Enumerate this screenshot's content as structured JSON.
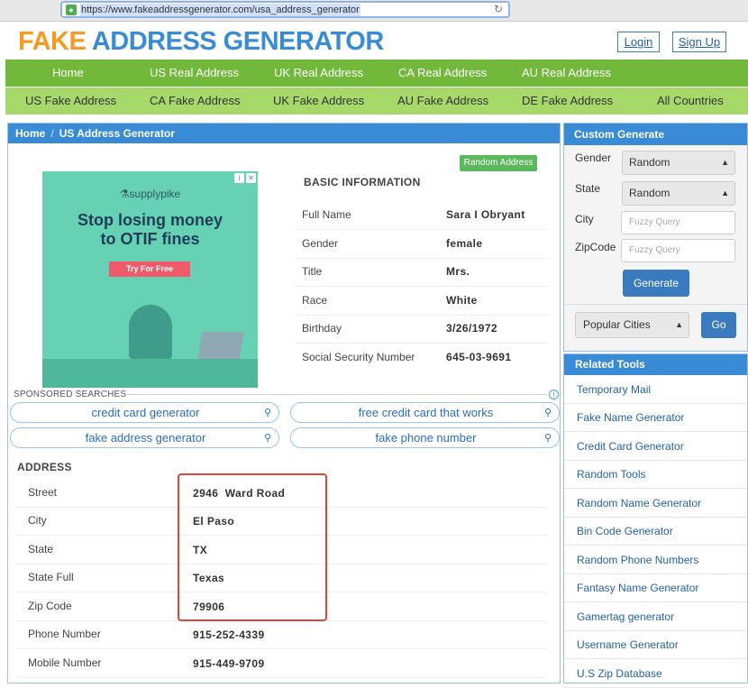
{
  "browser": {
    "url": "https://www.fakeaddressgenerator.com/usa_address_generator"
  },
  "header": {
    "logo_part1": "FAKE",
    "logo_part2": "ADDRESS GENERATOR",
    "login": "Login",
    "signup": "Sign Up"
  },
  "nav_primary": [
    "Home",
    "US Real Address",
    "UK Real Address",
    "CA Real Address",
    "AU Real Address"
  ],
  "nav_secondary": [
    "US Fake Address",
    "CA Fake Address",
    "UK Fake Address",
    "AU Fake Address",
    "DE Fake Address",
    "All Countries"
  ],
  "breadcrumb": {
    "home": "Home",
    "sep": "/",
    "current": "US Address Generator"
  },
  "ad": {
    "brand": "⚗supplypike",
    "title_line1": "Stop losing money",
    "title_line2": "to OTIF fines",
    "cta": "Try For Free"
  },
  "basic": {
    "random_button": "Random Address",
    "title": "BASIC INFORMATION",
    "rows": [
      {
        "label": "Full Name",
        "value": "Sara I Obryant"
      },
      {
        "label": "Gender",
        "value": "female"
      },
      {
        "label": "Title",
        "value": "Mrs."
      },
      {
        "label": "Race",
        "value": "White"
      },
      {
        "label": "Birthday",
        "value": "3/26/1972"
      },
      {
        "label": "Social Security Number",
        "value": "645-03-9691"
      }
    ]
  },
  "sponsored": {
    "label": "SPONSORED SEARCHES",
    "links": [
      "credit card generator",
      "free credit card that works",
      "fake address generator",
      "fake phone number"
    ]
  },
  "address": {
    "title": "ADDRESS",
    "rows": [
      {
        "label": "Street",
        "value": "2946  Ward Road"
      },
      {
        "label": "City",
        "value": "El Paso"
      },
      {
        "label": "State",
        "value": "TX"
      },
      {
        "label": "State Full",
        "value": "Texas"
      },
      {
        "label": "Zip Code",
        "value": "79906"
      },
      {
        "label": "Phone Number",
        "value": "915-252-4339"
      },
      {
        "label": "Mobile Number",
        "value": "915-449-9709"
      }
    ]
  },
  "custom": {
    "title": "Custom Generate",
    "gender_label": "Gender",
    "gender_value": "Random",
    "state_label": "State",
    "state_value": "Random",
    "city_label": "City",
    "city_placeholder": "Fuzzy Query",
    "zip_label": "ZipCode",
    "zip_placeholder": "Fuzzy Query",
    "generate": "Generate",
    "popular": "Popular Cities",
    "go": "Go"
  },
  "tools": {
    "title": "Related Tools",
    "items": [
      "Temporary Mail",
      "Fake Name Generator",
      "Credit Card Generator",
      "Random Tools",
      "Random Name Generator",
      "Bin Code Generator",
      "Random Phone Numbers",
      "Fantasy Name Generator",
      "Gamertag generator",
      "Username Generator",
      "U.S Zip Database"
    ]
  }
}
